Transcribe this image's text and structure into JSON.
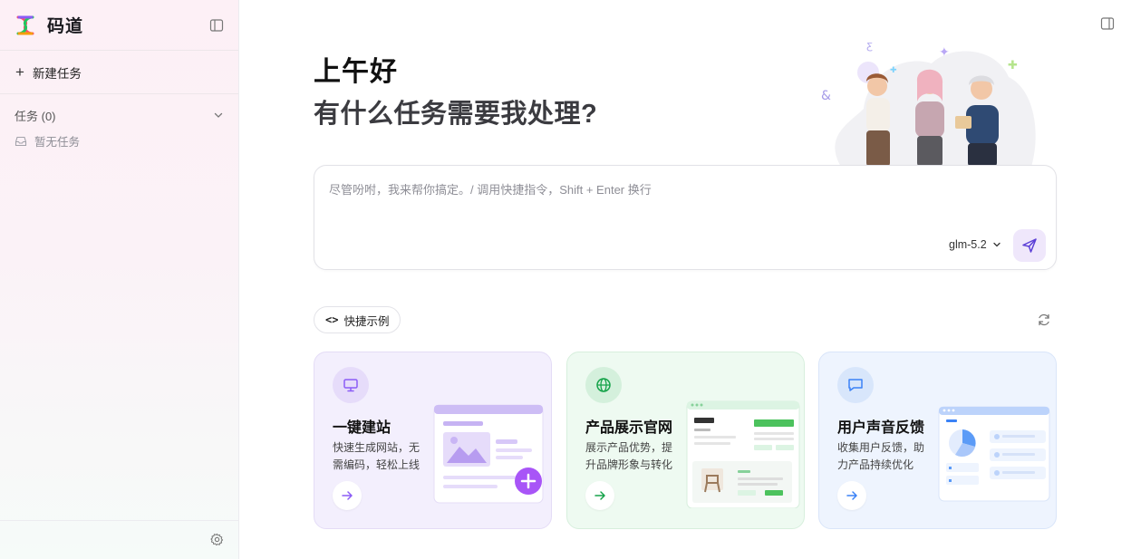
{
  "sidebar": {
    "app_name": "码道",
    "new_task_label": "新建任务",
    "task_group_label": "任务 (0)",
    "empty_label": "暂无任务"
  },
  "main": {
    "greeting": "上午好",
    "question": "有什么任务需要我处理?",
    "composer": {
      "placeholder": "尽管吩咐，我来帮你搞定。/ 调用快捷指令，Shift + Enter 换行",
      "value": "",
      "model": "glm-5.2"
    },
    "examples_label": "快捷示例",
    "cards": [
      {
        "title": "一键建站",
        "desc": "快速生成网站，无需编码，轻松上线",
        "icon": "monitor-icon",
        "accent": "#8b5cf6"
      },
      {
        "title": "产品展示官网",
        "desc": "展示产品优势，提升品牌形象与转化",
        "icon": "globe-icon",
        "accent": "#16a34a"
      },
      {
        "title": "用户声音反馈",
        "desc": "收集用户反馈，助力产品持续优化",
        "icon": "message-icon",
        "accent": "#3b82f6"
      }
    ]
  }
}
